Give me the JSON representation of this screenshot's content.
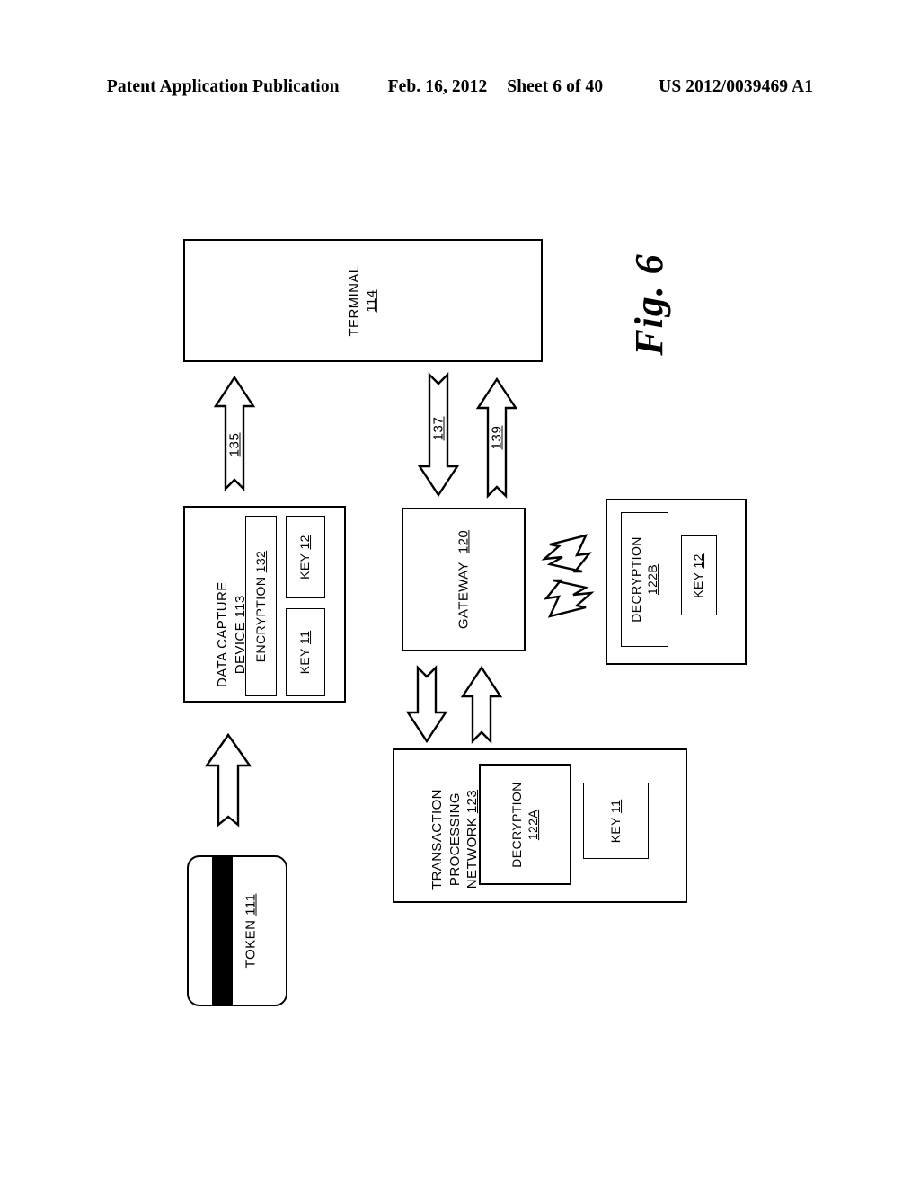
{
  "header": {
    "publication": "Patent Application Publication",
    "date": "Feb. 16, 2012",
    "sheet": "Sheet 6 of 40",
    "docnum": "US 2012/0039469 A1"
  },
  "figure": {
    "caption": "Fig. 6",
    "orientation": "rotated-90-ccw",
    "terminal": {
      "title": "TERMINAL",
      "ref": "114"
    },
    "data_capture_device": {
      "title_line1": "DATA CAPTURE",
      "title_line2": "DEVICE",
      "ref": "113",
      "encryption": {
        "title": "ENCRYPTION",
        "ref": "132"
      },
      "key_a": {
        "title": "KEY",
        "ref": "11"
      },
      "key_b": {
        "title": "KEY",
        "ref": "12"
      }
    },
    "gateway": {
      "title": "GATEWAY",
      "ref": "120"
    },
    "decryption_b_group": {
      "decryption": {
        "title": "DECRYPTION",
        "ref": "122B"
      },
      "key": {
        "title": "KEY",
        "ref": "12"
      }
    },
    "transaction_processing_network": {
      "title_line1": "TRANSACTION",
      "title_line2": "PROCESSING",
      "title_line3": "NETWORK",
      "ref": "123",
      "decryption": {
        "title": "DECRYPTION",
        "ref": "122A"
      },
      "key": {
        "title": "KEY",
        "ref": "11"
      }
    },
    "token": {
      "title": "TOKEN",
      "ref": "111"
    },
    "arrows": {
      "dcd_to_terminal": "135",
      "gateway_down": "137",
      "gateway_up": "139",
      "token_to_dcd": "",
      "gateway_to_tpn": "",
      "tpn_to_gateway": ""
    }
  },
  "colors": {
    "ink": "#000000",
    "paper": "#ffffff"
  }
}
